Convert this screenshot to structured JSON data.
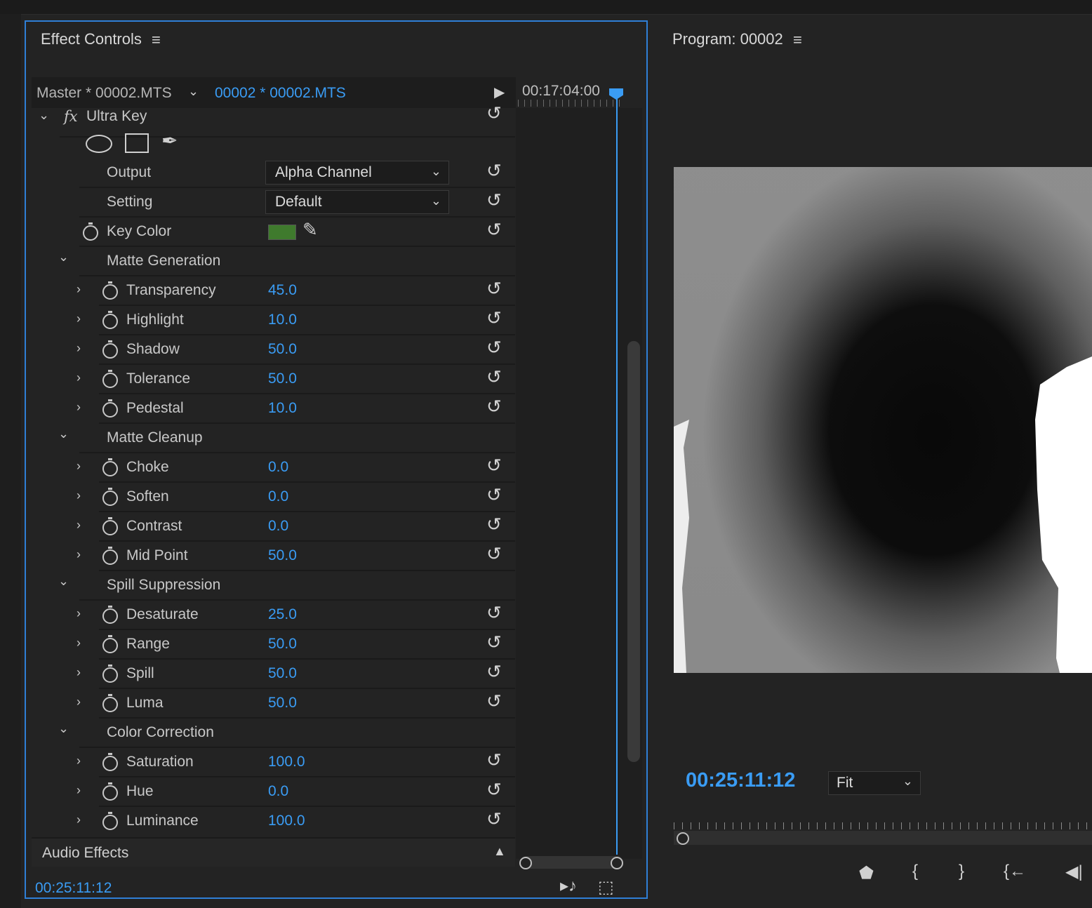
{
  "effect_controls": {
    "title": "Effect Controls",
    "master_clip": "Master * 00002.MTS",
    "active_clip": "00002 * 00002.MTS",
    "timeline_timecode": "00:17:04:00",
    "current_timecode": "00:25:11:12",
    "effect_name": "Ultra Key",
    "output": {
      "label": "Output",
      "value": "Alpha Channel"
    },
    "setting": {
      "label": "Setting",
      "value": "Default"
    },
    "key_color": {
      "label": "Key Color",
      "color": "#3f7a2d"
    },
    "groups": [
      {
        "name": "Matte Generation",
        "params": [
          {
            "label": "Transparency",
            "value": "45.0"
          },
          {
            "label": "Highlight",
            "value": "10.0"
          },
          {
            "label": "Shadow",
            "value": "50.0"
          },
          {
            "label": "Tolerance",
            "value": "50.0"
          },
          {
            "label": "Pedestal",
            "value": "10.0"
          }
        ]
      },
      {
        "name": "Matte Cleanup",
        "params": [
          {
            "label": "Choke",
            "value": "0.0"
          },
          {
            "label": "Soften",
            "value": "0.0"
          },
          {
            "label": "Contrast",
            "value": "0.0"
          },
          {
            "label": "Mid Point",
            "value": "50.0"
          }
        ]
      },
      {
        "name": "Spill Suppression",
        "params": [
          {
            "label": "Desaturate",
            "value": "25.0"
          },
          {
            "label": "Range",
            "value": "50.0"
          },
          {
            "label": "Spill",
            "value": "50.0"
          },
          {
            "label": "Luma",
            "value": "50.0"
          }
        ]
      },
      {
        "name": "Color Correction",
        "params": [
          {
            "label": "Saturation",
            "value": "100.0"
          },
          {
            "label": "Hue",
            "value": "0.0"
          },
          {
            "label": "Luminance",
            "value": "100.0"
          }
        ]
      }
    ],
    "audio_effects": "Audio Effects"
  },
  "program": {
    "title": "Program: 00002",
    "timecode": "00:25:11:12",
    "zoom": "Fit"
  },
  "colors": {
    "accent": "#3a9cf4",
    "panel_border": "#2f7fd6"
  }
}
